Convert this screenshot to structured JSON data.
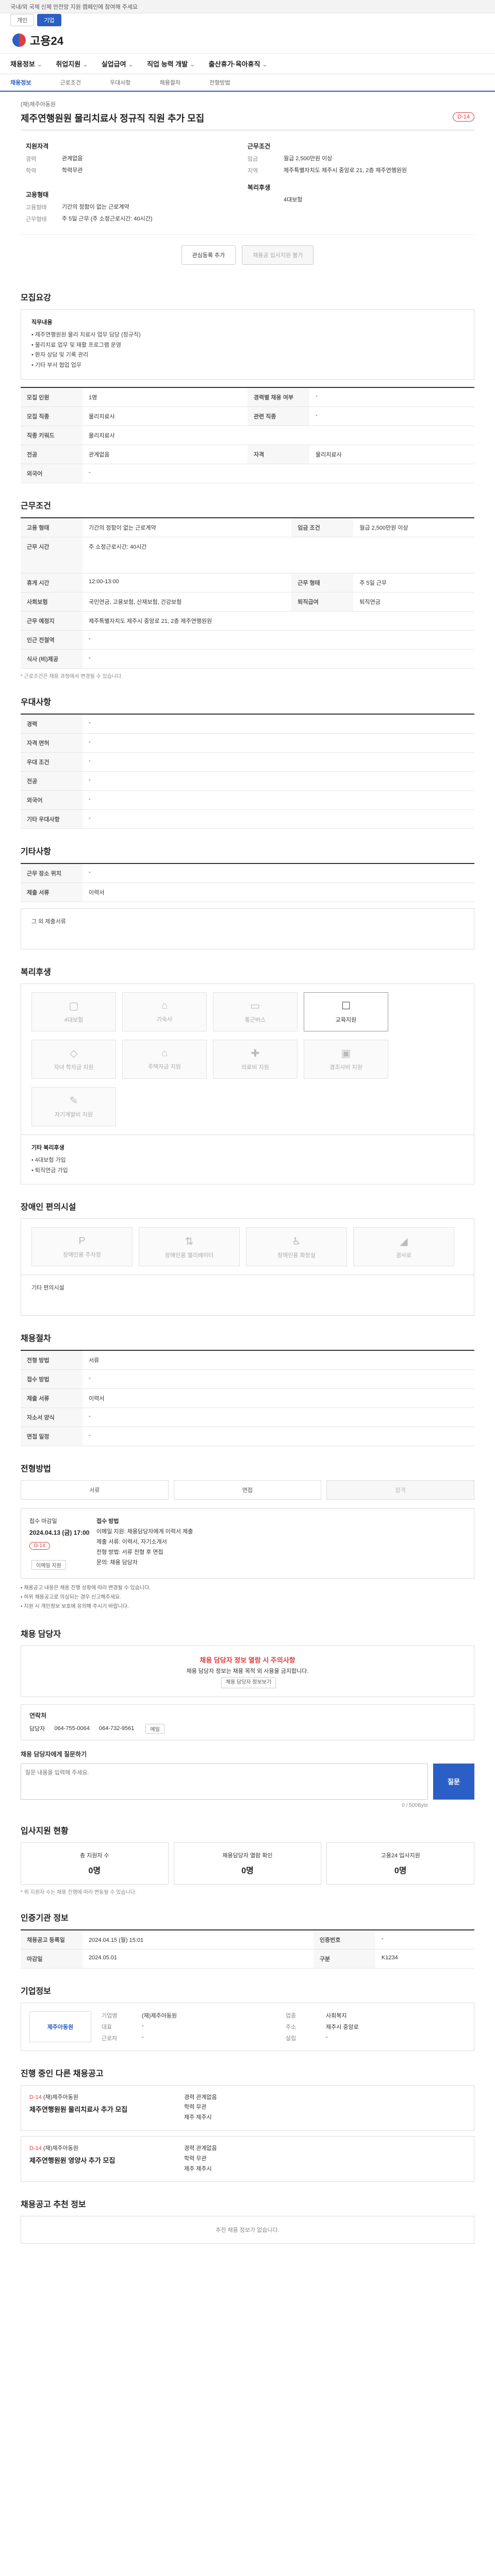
{
  "notice": "국내/외 국제 신체 안전망 지원 캠페인에 참여해 주세요",
  "switch": [
    "개인",
    "기업"
  ],
  "brand": "고용24",
  "gnb": [
    "채용정보",
    "취업지원",
    "실업급여",
    "직업 능력 개발",
    "출산휴가·육아휴직"
  ],
  "sub": [
    "채용정보",
    "근로조건",
    "우대사항",
    "채용절차",
    "전형방법"
  ],
  "job": {
    "company": "(재)제주아동원",
    "title": "제주연행원원 물리치료사 정규직 직원 추가 모집",
    "dday": "D-14"
  },
  "summary": {
    "left_head": "지원자격",
    "left": [
      [
        "경력",
        "관계없음"
      ],
      [
        "학력",
        "학력무관"
      ]
    ],
    "right_head": "근무조건",
    "right": [
      [
        "임금",
        "월급 2,500만원 이상"
      ],
      [
        "지역",
        "제주특별자치도 제주시 중앙로 21, 2층 제주연행원원"
      ]
    ],
    "left2_head": "고용형태",
    "left2": [
      [
        "고용형태",
        "기간의 정함이 없는 근로계약"
      ],
      [
        "근무형태",
        "주 5일 근무 (주 소정근로시간: 40시간)"
      ]
    ],
    "right2_head": "복리후생",
    "right2": [
      [
        "",
        "4대보험"
      ]
    ]
  },
  "actions": [
    "관심등록 추가",
    "채용공 입사지원 불가"
  ],
  "s_detail": "모집요강",
  "detail_head": "직무내용",
  "detail_lines": [
    "• 제주연행원원 물리 치료사 업무 담당 (정규직)",
    "• 물리치료 업무 및 재활 프로그램 운영",
    "• 환자 상담 및 기록 관리",
    "• 기타 부서 협업 업무"
  ],
  "rows1": [
    [
      "모집 인원",
      "1명",
      "경력별 채용 여부",
      "-"
    ],
    [
      "모집 직종",
      "물리치료사",
      "관련 직종",
      "-"
    ],
    [
      "직종 키워드",
      "물리치료사",
      "",
      ""
    ],
    [
      "전공",
      "관계없음",
      "자격",
      "물리치료사"
    ],
    [
      "외국어",
      "-",
      "",
      ""
    ]
  ],
  "s_cond": "근무조건",
  "cond": [
    [
      "고용 형태",
      "기간의 정함이 없는 근로계약",
      "임금 조건",
      "월급 2,500만원 이상"
    ],
    [
      "근무 시간",
      "주 소정근로시간: 40시간",
      "",
      ""
    ],
    [
      "휴게 시간",
      "12:00-13:00",
      "근무 형태",
      "주 5일 근무"
    ],
    [
      "사회보험",
      "국민연금, 고용보험, 산재보험, 건강보험",
      "퇴직급여",
      "퇴직연금"
    ],
    [
      "근무 예정지",
      "제주특별자치도 제주시 중앙로 21, 2층 제주연행원원",
      "",
      ""
    ],
    [
      "인근 전철역",
      "-",
      "",
      ""
    ],
    [
      "식사 (비)제공",
      "-",
      "",
      ""
    ]
  ],
  "cond_note": "* 근로조건은 채용 과정에서 변경될 수 있습니다.",
  "s_pref": "우대사항",
  "pref": [
    [
      "경력",
      "-"
    ],
    [
      "자격 면허",
      "-"
    ],
    [
      "우대 조건",
      "-"
    ],
    [
      "전공",
      "-"
    ],
    [
      "외국어",
      "-"
    ],
    [
      "기타 우대사항",
      "-"
    ]
  ],
  "s_etc": "기타사항",
  "etc": [
    [
      "근무 장소 위치",
      "-"
    ],
    [
      "제출 서류",
      "이력서"
    ]
  ],
  "etc_box": "그 외 제출서류",
  "s_welfare": "복리후생",
  "welfare": [
    "4대보험",
    "기숙사",
    "통근버스",
    "교육지원",
    "자녀 학자금 지원",
    "주택자금 지원",
    "의료비 지원",
    "경조사비 지원",
    "자기계발비 지원"
  ],
  "welfare_box": [
    "기타 복리후생",
    "• 4대보험 가입",
    "• 퇴직연금 가입"
  ],
  "s_disab": "장애인 편의시설",
  "disab": [
    "장애인용 주차장",
    "장애인용 엘리베이터",
    "장애인용 화장실",
    "경사로"
  ],
  "disab_box": "기타 편의시설",
  "s_proc": "채용절차",
  "proc": [
    [
      "전형 방법",
      "서류"
    ],
    [
      "접수 방법",
      "-"
    ],
    [
      "제출 서류",
      "이력서"
    ],
    [
      "자소서 양식",
      "-"
    ],
    [
      "면접 일정",
      "-"
    ]
  ],
  "s_method": "전형방법",
  "steps": [
    "서류",
    "면접",
    "합격"
  ],
  "jb": {
    "title": "접수 마감일",
    "date": "2024.04.13 (금) 17:00",
    "dday": "D-14",
    "apply": "이메일 지원",
    "head": "접수 방법",
    "lines": [
      "이메일 지원: 채용담당자에게 이력서 제출",
      "제출 서류: 이력서, 자기소개서",
      "전형 방법: 서류 전형 후 면접",
      "문의: 채용 담당자"
    ]
  },
  "bul": [
    "• 채용공고 내용은 채용 진행 상황에 따라 변경될 수 있습니다.",
    "• 허위 채용공고로 의심되는 경우 신고해주세요.",
    "• 지원 시 개인정보 보호에 유의해 주시기 바랍니다."
  ],
  "s_contact": "채용 담당자",
  "warn": [
    "채용 담당자 정보 열람 시 주의사항",
    "채용 담당자 정보는 채용 목적 외 사용을 금지합니다.",
    "채용 담당자 정보보기"
  ],
  "contact": {
    "head": "연락처",
    "name": "담당자",
    "tel": "064-755-0064",
    "fax": "064-732-9561",
    "mail": "메일"
  },
  "qa": {
    "head": "채용 담당자에게 질문하기",
    "ph": "질문 내용을 입력해 주세요.",
    "btn": "질문",
    "count": "0 / 500Byte"
  },
  "s_stat": "입사지원 현황",
  "stat": [
    [
      "총 지원자 수",
      "0명"
    ],
    [
      "채용담당자 열람 확인",
      "0명"
    ],
    [
      "고용24 입사지원",
      "0명"
    ]
  ],
  "stat_note": "* 위 지원자 수는 채용 진행에 따라 변동될 수 있습니다.",
  "s_info": "인증기관 정보",
  "info": [
    [
      "채용공고 등록일",
      "2024.04.15 (월) 15:01",
      "인증번호",
      "-"
    ],
    [
      "마감일",
      "2024.05.01",
      "구분",
      "K1234"
    ]
  ],
  "s_co": "기업정보",
  "co": {
    "logo": "제주아동원",
    "rows": [
      [
        "기업명",
        "(재)제주아동원",
        "업종",
        "사회복지"
      ],
      [
        "대표",
        "-",
        "주소",
        "제주시 중앙로"
      ],
      [
        "근로자",
        "-",
        "설립",
        "-"
      ]
    ]
  },
  "s_rel": "진행 중인 다른 채용공고",
  "rel": [
    {
      "d": "D-14",
      "co": "(재)제주아동원",
      "t": "제주연행원원 물리치료사 추가 모집",
      "c": [
        "경력 관계없음",
        "학력 무관",
        "제주 제주시"
      ]
    },
    {
      "d": "D-14",
      "co": "(재)제주아동원",
      "t": "제주연행원원 영양사 추가 모집",
      "c": [
        "경력 관계없음",
        "학력 무관",
        "제주 제주시"
      ]
    }
  ],
  "s_reco": "채용공고 추천 정보",
  "reco_empty": "추천 채용 정보가 없습니다."
}
